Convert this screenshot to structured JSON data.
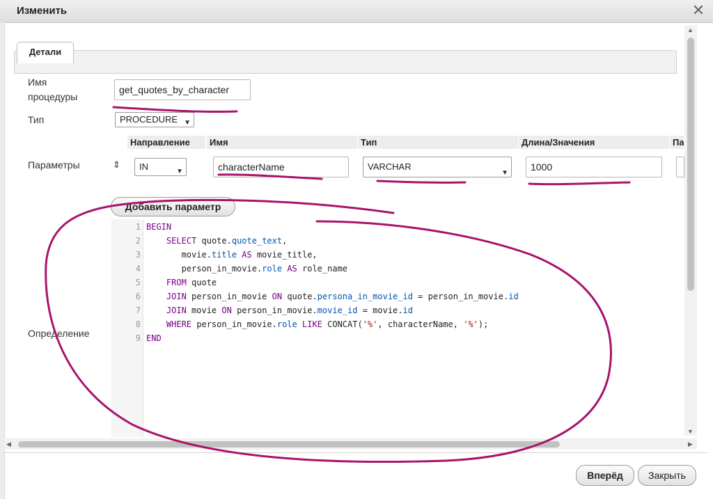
{
  "dialog": {
    "title": "Изменить"
  },
  "tabs": {
    "details": "Детали"
  },
  "form": {
    "procedure_name_label": "Имя процедуры",
    "procedure_name_value": "get_quotes_by_character",
    "type_label": "Тип",
    "type_value": "PROCEDURE",
    "params_label": "Параметры",
    "definition_label": "Определение"
  },
  "params": {
    "headers": {
      "direction": "Направление",
      "name": "Имя",
      "type": "Тип",
      "length": "Длина/Значения",
      "extra": "Па"
    },
    "row": {
      "sort_icon": "⇕",
      "direction": "IN",
      "name": "characterName",
      "type": "VARCHAR",
      "length": "1000"
    },
    "add_button": "Добавить параметр"
  },
  "editor": {
    "line_numbers": [
      "1",
      "2",
      "3",
      "4",
      "5",
      "6",
      "7",
      "8",
      "9"
    ],
    "lines": [
      "BEGIN",
      "    SELECT quote.quote_text,",
      "       movie.title AS movie_title,",
      "       person_in_movie.role AS role_name",
      "    FROM quote",
      "    JOIN person_in_movie ON quote.persona_in_movie_id = person_in_movie.id",
      "    JOIN movie ON person_in_movie.movie_id = movie.id",
      "    WHERE person_in_movie.role LIKE CONCAT('%', characterName, '%');",
      "END"
    ]
  },
  "footer": {
    "forward_button": "Вперёд",
    "close_button": "Закрыть"
  },
  "colors": {
    "annotation": "#a8136b",
    "keyword": "#770088",
    "property": "#0055aa",
    "string": "#aa1111"
  },
  "icons": {
    "close": "close-icon",
    "sort": "sort-icon",
    "chevron": "chevron-down-icon"
  }
}
